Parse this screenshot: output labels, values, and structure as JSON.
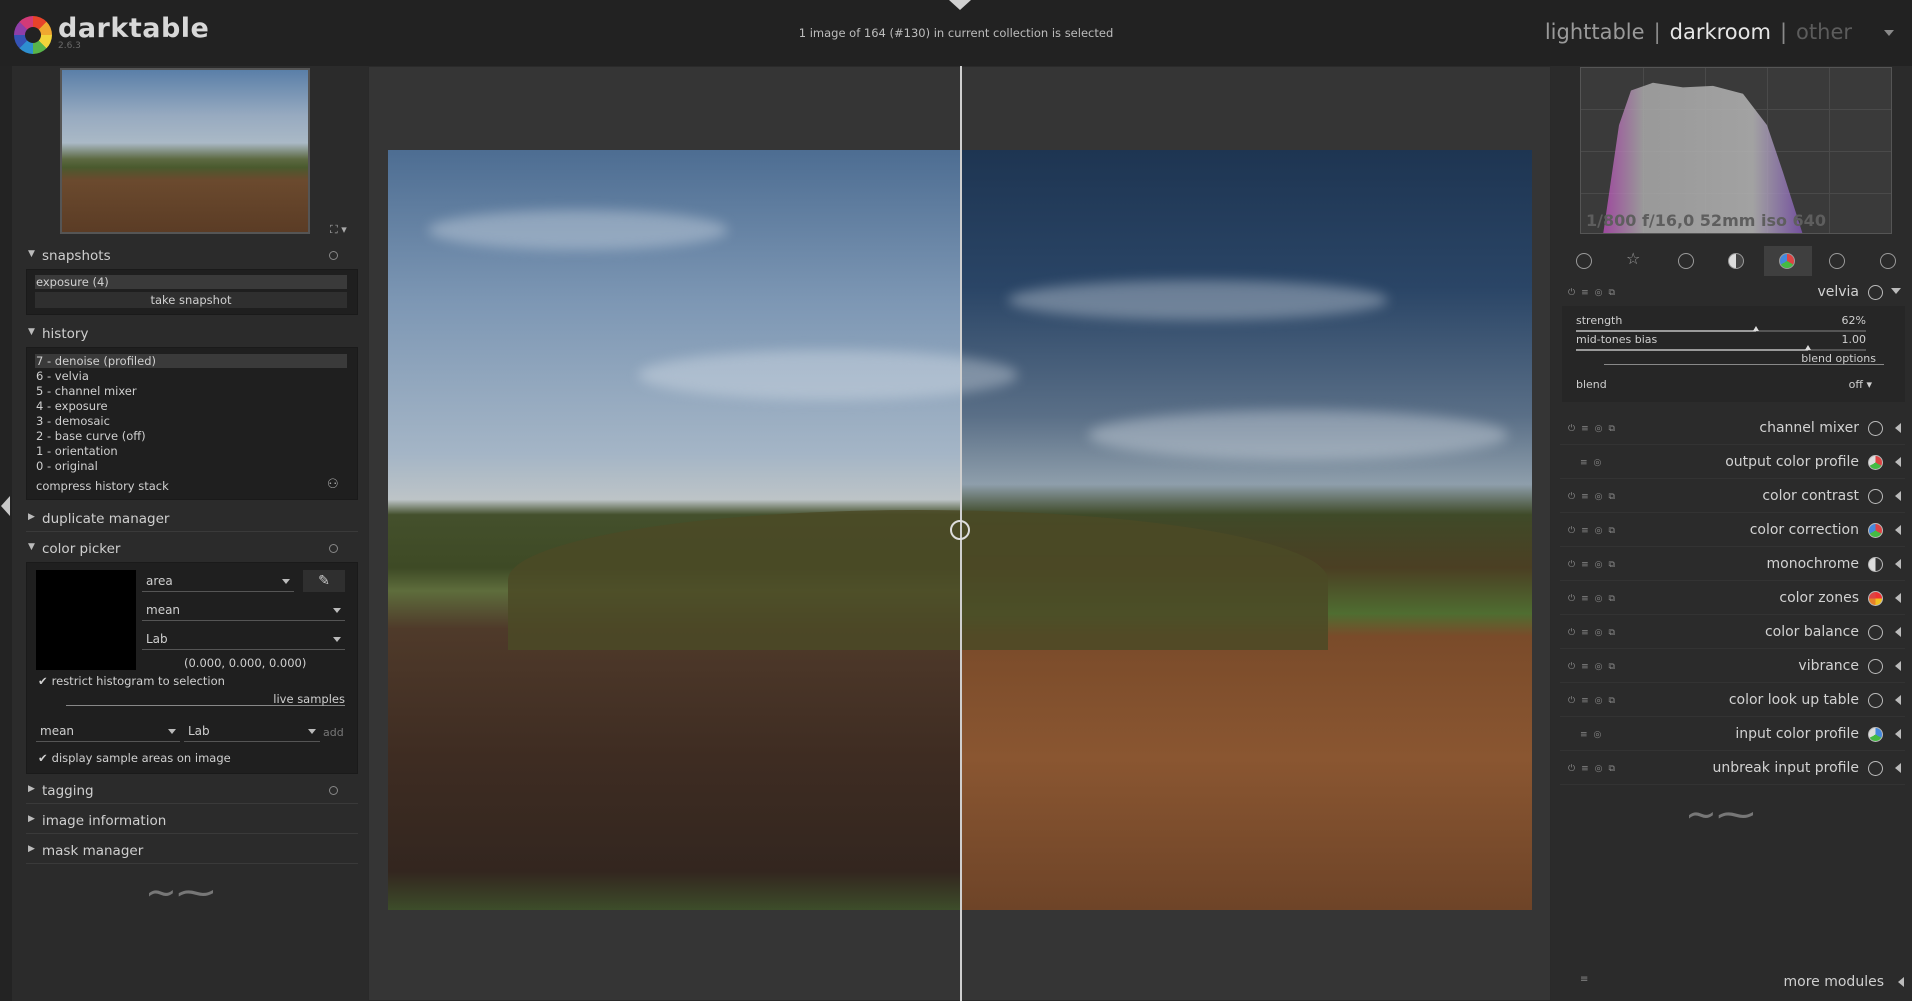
{
  "app": {
    "name": "darktable",
    "version": "2.6.3"
  },
  "status": "1 image of 164 (#130) in current collection is selected",
  "views": {
    "lighttable": "lighttable",
    "darkroom": "darkroom",
    "other": "other",
    "separator": "|"
  },
  "left": {
    "snapshots": {
      "title": "snapshots",
      "item": "exposure (4)",
      "button": "take snapshot"
    },
    "history": {
      "title": "history",
      "items": [
        "7 - denoise (profiled)",
        "6 - velvia",
        "5 - channel mixer",
        "4 - exposure",
        "3 - demosaic",
        "2 - base curve (off)",
        "1 - orientation",
        "0 - original"
      ],
      "compress": "compress history stack"
    },
    "duplicate_manager": {
      "title": "duplicate manager"
    },
    "color_picker": {
      "title": "color picker",
      "mode": "area",
      "statistic": "mean",
      "colorspace": "Lab",
      "value": "(0.000, 0.000, 0.000)",
      "restrict": "restrict histogram to selection",
      "live_samples": "live samples",
      "sample_stat": "mean",
      "sample_space": "Lab",
      "add": "add",
      "display": "display sample areas on image"
    },
    "tagging": {
      "title": "tagging"
    },
    "image_information": {
      "title": "image information"
    },
    "mask_manager": {
      "title": "mask manager"
    }
  },
  "histogram": {
    "exif": "1/800 f/16,0 52mm iso 640"
  },
  "module_groups": [
    "power-icon",
    "star-icon",
    "circle-icon",
    "tone-icon",
    "color-icon",
    "correct-icon",
    "effect-icon"
  ],
  "velvia": {
    "name": "velvia",
    "strength_label": "strength",
    "strength_value": "62%",
    "strength": 0.62,
    "midtones_label": "mid-tones bias",
    "midtones_value": "1.00",
    "midtones": 0.8,
    "blend_options": "blend options",
    "blend_label": "blend",
    "blend_value": "off"
  },
  "modules": [
    "channel mixer",
    "output color profile",
    "color contrast",
    "color correction",
    "monochrome",
    "color zones",
    "color balance",
    "vibrance",
    "color look up table",
    "input color profile",
    "unbreak input profile"
  ],
  "more_modules": "more modules"
}
